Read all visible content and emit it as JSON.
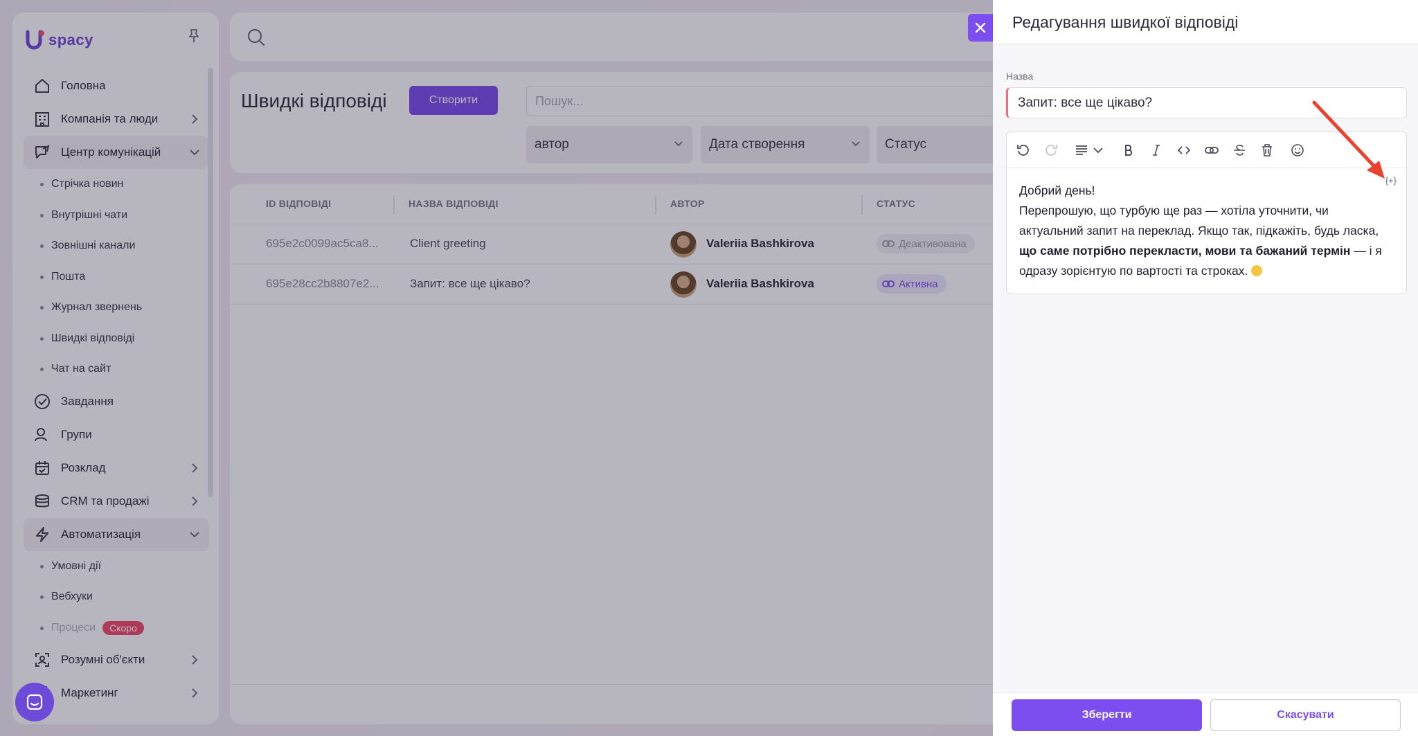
{
  "app": {
    "logo_text": "spacy",
    "logo_letter": "U"
  },
  "sidebar": {
    "items": [
      {
        "label": "Головна",
        "icon": "home-icon"
      },
      {
        "label": "Компанія та люди",
        "icon": "company-icon",
        "expandable": true
      },
      {
        "label": "Центр комунікацій",
        "icon": "communications-icon",
        "expanded": true
      },
      {
        "label": "Завдання",
        "icon": "tasks-icon"
      },
      {
        "label": "Групи",
        "icon": "groups-icon"
      },
      {
        "label": "Розклад",
        "icon": "calendar-icon",
        "expandable": true
      },
      {
        "label": "CRM та продажі",
        "icon": "crm-icon",
        "expandable": true
      },
      {
        "label": "Автоматизація",
        "icon": "automation-icon",
        "expanded": true
      },
      {
        "label": "Розумні об'єкти",
        "icon": "smart-objects-icon",
        "expandable": true
      },
      {
        "label": "Маркетинг",
        "icon": "marketing-icon",
        "expandable": true
      }
    ],
    "communications_sub": [
      "Стрічка новин",
      "Внутрішні чати",
      "Зовнішні канали",
      "Пошта",
      "Журнал звернень",
      "Швидкі відповіді",
      "Чат на сайт"
    ],
    "automation_sub": [
      "Умовні дії",
      "Вебхуки",
      "Процеси"
    ],
    "soon_badge": "Скоро"
  },
  "page": {
    "title": "Швидкі відповіді",
    "create_label": "Створити",
    "search_placeholder": "Пошук...",
    "filters": [
      "автор",
      "Дата створення",
      "Статус"
    ]
  },
  "table": {
    "columns": [
      "ID ВІДПОВІДІ",
      "НАЗВА ВІДПОВІДІ",
      "АВТОР",
      "СТАТУС"
    ],
    "rows": [
      {
        "id": "695e2c0099ac5ca8...",
        "name": "Client greeting",
        "author": "Valeriia Bashkirova",
        "status": "Деактивована"
      },
      {
        "id": "695e28cc2b8807e2...",
        "name": "Запит: все ще цікаво?",
        "author": "Valeriia Bashkirova",
        "status": "Активна"
      }
    ]
  },
  "drawer": {
    "title": "Редагування швидкої відповіді",
    "name_label": "Назва",
    "name_value": "Запит: все ще цікаво?",
    "insert_variable": "{+}",
    "content": {
      "line1": "Добрий день!",
      "line2_start": "Перепрошую, що турбую ще раз — хотіла уточнити, чи актуальний запит на переклад. Якщо так, підкажіть, будь ласка, ",
      "line2_bold": "що саме потрібно перекласти, мови та бажаний термін",
      "line2_end": " — і я одразу зорієнтую по вартості та строках. "
    },
    "save_label": "Зберегти",
    "cancel_label": "Скасувати"
  },
  "colors": {
    "accent": "#7c4ef0",
    "active_badge_bg": "#efe9ff",
    "error_border": "#f06a7e",
    "annotation_arrow": "#e8432f"
  }
}
